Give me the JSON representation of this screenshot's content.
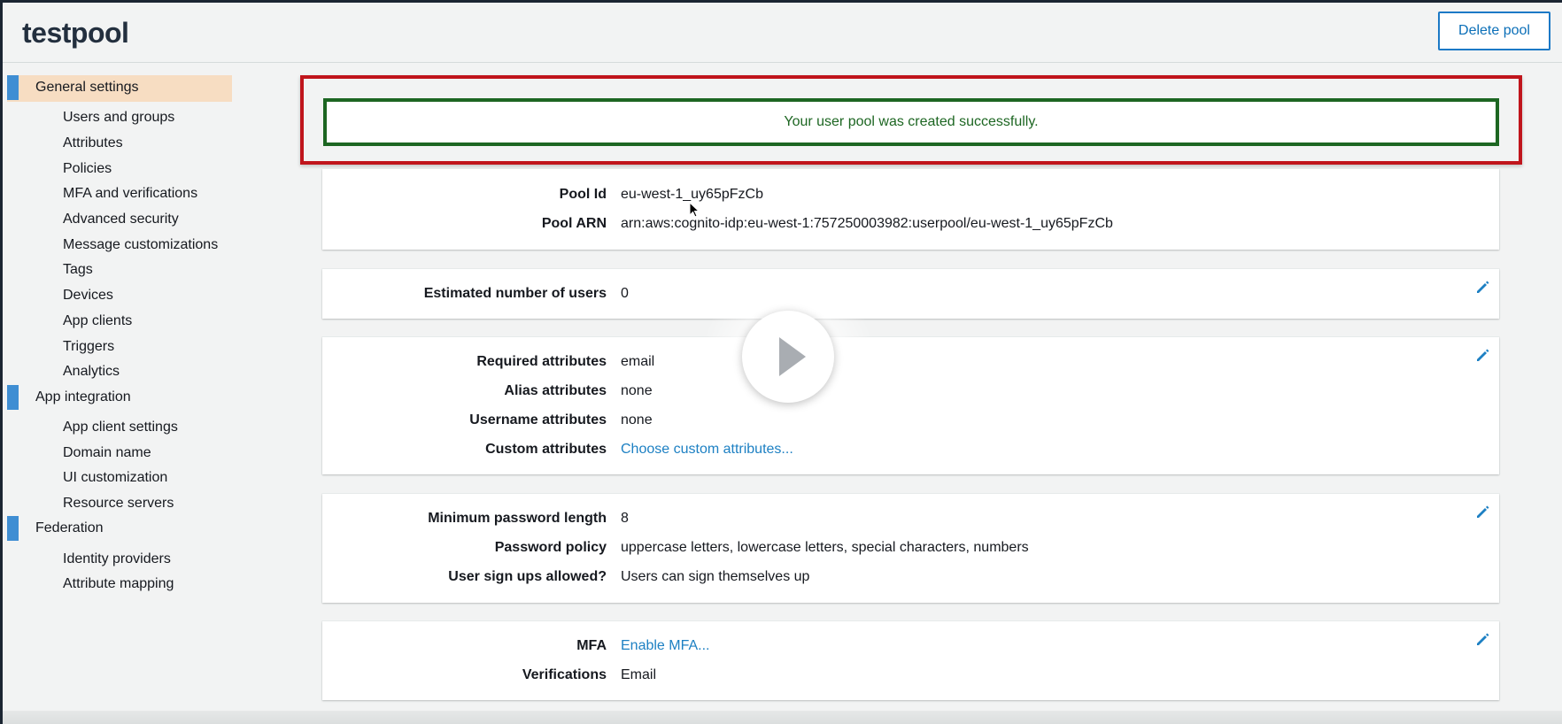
{
  "header": {
    "title": "testpool",
    "delete_label": "Delete pool"
  },
  "sidebar": {
    "sections": [
      {
        "label": "General settings",
        "active": true,
        "items": [
          "Users and groups",
          "Attributes",
          "Policies",
          "MFA and verifications",
          "Advanced security",
          "Message customizations",
          "Tags",
          "Devices",
          "App clients",
          "Triggers",
          "Analytics"
        ]
      },
      {
        "label": "App integration",
        "active": false,
        "items": [
          "App client settings",
          "Domain name",
          "UI customization",
          "Resource servers"
        ]
      },
      {
        "label": "Federation",
        "active": false,
        "items": [
          "Identity providers",
          "Attribute mapping"
        ]
      }
    ]
  },
  "notification": {
    "message": "Your user pool was created successfully."
  },
  "pool": {
    "id_label": "Pool Id",
    "id_value": "eu-west-1_uy65pFzCb",
    "arn_label": "Pool ARN",
    "arn_value": "arn:aws:cognito-idp:eu-west-1:757250003982:userpool/eu-west-1_uy65pFzCb"
  },
  "users": {
    "estimated_label": "Estimated number of users",
    "estimated_value": "0"
  },
  "attributes": {
    "required_label": "Required attributes",
    "required_value": "email",
    "alias_label": "Alias attributes",
    "alias_value": "none",
    "username_label": "Username attributes",
    "username_value": "none",
    "custom_label": "Custom attributes",
    "custom_value": "Choose custom attributes..."
  },
  "password": {
    "min_length_label": "Minimum password length",
    "min_length_value": "8",
    "policy_label": "Password policy",
    "policy_value": "uppercase letters, lowercase letters, special characters, numbers",
    "signups_label": "User sign ups allowed?",
    "signups_value": "Users can sign themselves up"
  },
  "mfa": {
    "mfa_label": "MFA",
    "mfa_value": "Enable MFA...",
    "verifications_label": "Verifications",
    "verifications_value": "Email"
  },
  "colors": {
    "link": "#1d80c3",
    "success": "#1d6622",
    "highlight_border": "#c0151c",
    "active_nav": "#f7ddc2",
    "nav_bar": "#3f8ed3"
  },
  "icons": {
    "edit": "pencil-icon",
    "play": "play-icon",
    "cursor": "mouse-pointer-icon"
  }
}
